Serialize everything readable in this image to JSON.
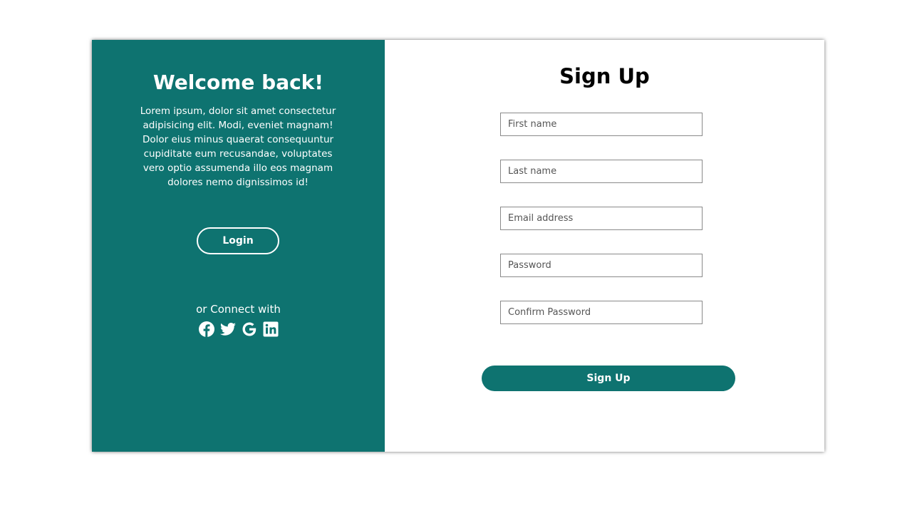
{
  "left_panel": {
    "title": "Welcome back!",
    "description": "Lorem ipsum, dolor sit amet consectetur adipisicing elit. Modi, eveniet magnam! Dolor eius minus quaerat consequuntur cupiditate eum recusandae, voluptates vero optio assumenda illo eos magnam dolores nemo dignissimos id!",
    "login_label": "Login",
    "connect_label": "or Connect with",
    "social_icons": [
      "facebook-icon",
      "twitter-icon",
      "google-icon",
      "linkedin-icon"
    ]
  },
  "right_panel": {
    "title": "Sign Up",
    "fields": {
      "first_name": {
        "placeholder": "First name",
        "value": ""
      },
      "last_name": {
        "placeholder": "Last name",
        "value": ""
      },
      "email": {
        "placeholder": "Email address",
        "value": ""
      },
      "password": {
        "placeholder": "Password",
        "value": ""
      },
      "confirm_password": {
        "placeholder": "Confirm Password",
        "value": ""
      }
    },
    "submit_label": "Sign Up"
  },
  "colors": {
    "accent": "#0e7370",
    "panel_text": "#ffffff",
    "field_border": "#8a8a8a"
  }
}
